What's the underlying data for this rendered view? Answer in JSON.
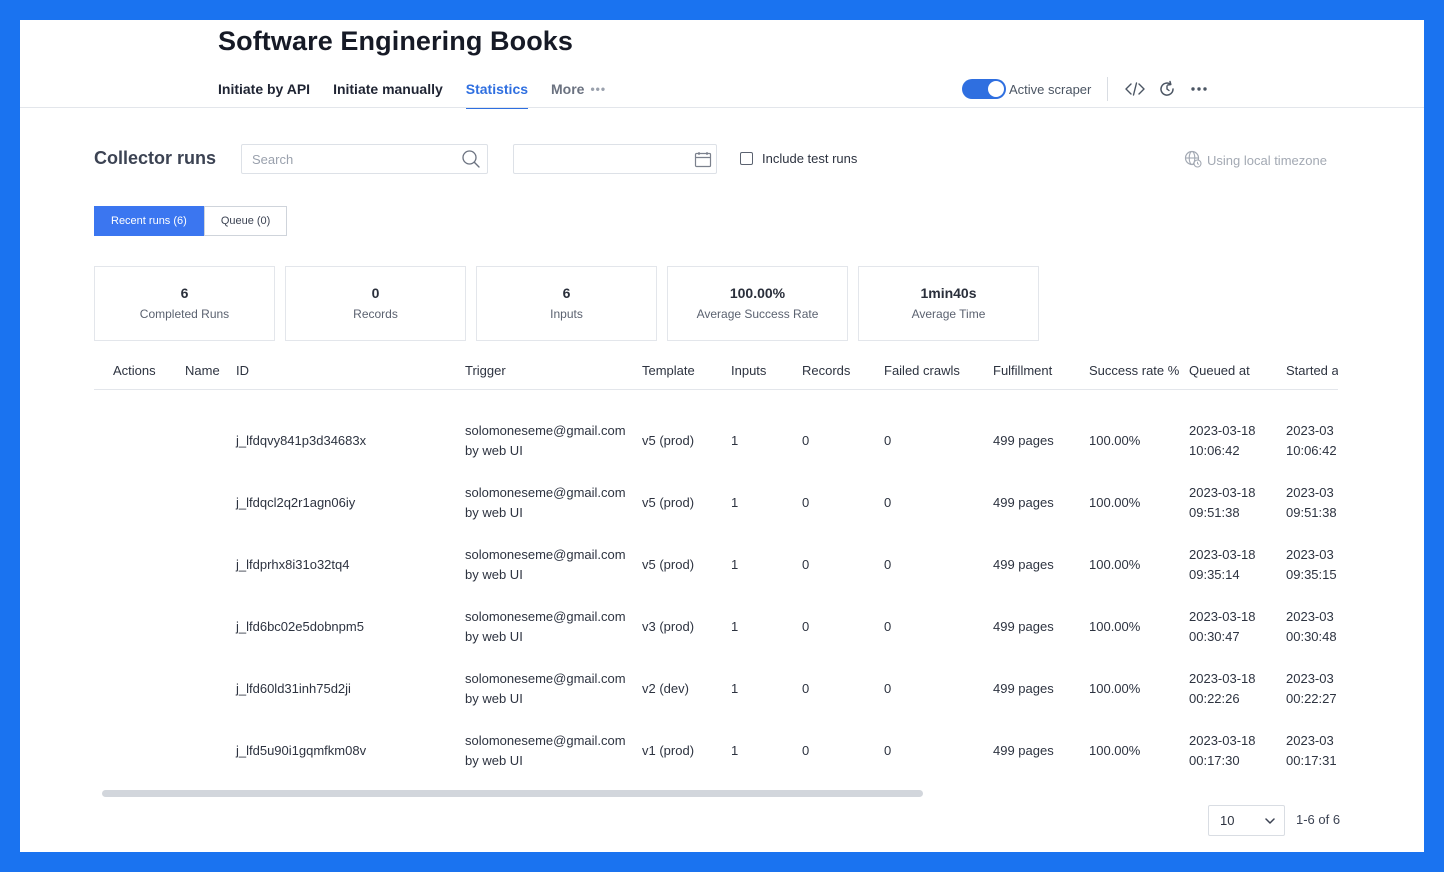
{
  "header": {
    "title": "Software Enginering Books",
    "tabs": [
      {
        "label": "Initiate by API"
      },
      {
        "label": "Initiate manually"
      },
      {
        "label": "Statistics"
      },
      {
        "label": "More"
      }
    ],
    "toggle_label": "Active scraper",
    "toggle_on": true,
    "icons": [
      "code-icon",
      "history-icon",
      "more-icon"
    ]
  },
  "controls": {
    "section_title": "Collector runs",
    "search_placeholder": "Search",
    "include_test_runs_label": "Include test runs",
    "include_test_runs_checked": false,
    "timezone_label": "Using local timezone"
  },
  "run_tabs": [
    {
      "label": "Recent runs (6)",
      "active": true
    },
    {
      "label": "Queue (0)",
      "active": false
    }
  ],
  "stats": [
    {
      "value": "6",
      "label": "Completed Runs"
    },
    {
      "value": "0",
      "label": "Records"
    },
    {
      "value": "6",
      "label": "Inputs"
    },
    {
      "value": "100.00%",
      "label": "Average Success Rate"
    },
    {
      "value": "1min40s",
      "label": "Average Time"
    }
  ],
  "table": {
    "columns": [
      "Actions",
      "Name",
      "ID",
      "Trigger",
      "Template",
      "Inputs",
      "Records",
      "Failed crawls",
      "Fulfillment",
      "Success rate %",
      "Queued at",
      "Started a"
    ],
    "rows": [
      {
        "id": "j_lfdqvy841p3d34683x",
        "trigger_email": "solomoneseme@gmail.com",
        "trigger_via": "by web UI",
        "template": "v5 (prod)",
        "inputs": "1",
        "records": "0",
        "failed": "0",
        "fulfillment": "499 pages",
        "success": "100.00%",
        "queued_date": "2023-03-18",
        "queued_time": "10:06:42",
        "started_date": "2023-03",
        "started_time": "10:06:42"
      },
      {
        "id": "j_lfdqcl2q2r1agn06iy",
        "trigger_email": "solomoneseme@gmail.com",
        "trigger_via": "by web UI",
        "template": "v5 (prod)",
        "inputs": "1",
        "records": "0",
        "failed": "0",
        "fulfillment": "499 pages",
        "success": "100.00%",
        "queued_date": "2023-03-18",
        "queued_time": "09:51:38",
        "started_date": "2023-03",
        "started_time": "09:51:38"
      },
      {
        "id": "j_lfdprhx8i31o32tq4",
        "trigger_email": "solomoneseme@gmail.com",
        "trigger_via": "by web UI",
        "template": "v5 (prod)",
        "inputs": "1",
        "records": "0",
        "failed": "0",
        "fulfillment": "499 pages",
        "success": "100.00%",
        "queued_date": "2023-03-18",
        "queued_time": "09:35:14",
        "started_date": "2023-03",
        "started_time": "09:35:15"
      },
      {
        "id": "j_lfd6bc02e5dobnpm5",
        "trigger_email": "solomoneseme@gmail.com",
        "trigger_via": "by web UI",
        "template": "v3 (prod)",
        "inputs": "1",
        "records": "0",
        "failed": "0",
        "fulfillment": "499 pages",
        "success": "100.00%",
        "queued_date": "2023-03-18",
        "queued_time": "00:30:47",
        "started_date": "2023-03",
        "started_time": "00:30:48"
      },
      {
        "id": "j_lfd60ld31inh75d2ji",
        "trigger_email": "solomoneseme@gmail.com",
        "trigger_via": "by web UI",
        "template": "v2 (dev)",
        "inputs": "1",
        "records": "0",
        "failed": "0",
        "fulfillment": "499 pages",
        "success": "100.00%",
        "queued_date": "2023-03-18",
        "queued_time": "00:22:26",
        "started_date": "2023-03",
        "started_time": "00:22:27"
      },
      {
        "id": "j_lfd5u90i1gqmfkm08v",
        "trigger_email": "solomoneseme@gmail.com",
        "trigger_via": "by web UI",
        "template": "v1 (prod)",
        "inputs": "1",
        "records": "0",
        "failed": "0",
        "fulfillment": "499 pages",
        "success": "100.00%",
        "queued_date": "2023-03-18",
        "queued_time": "00:17:30",
        "started_date": "2023-03",
        "started_time": "00:17:31"
      }
    ]
  },
  "pagination": {
    "page_size": "10",
    "range_label": "1-6 of 6"
  },
  "colors": {
    "accent": "#2f6fe0",
    "background": "#1a73f0"
  }
}
